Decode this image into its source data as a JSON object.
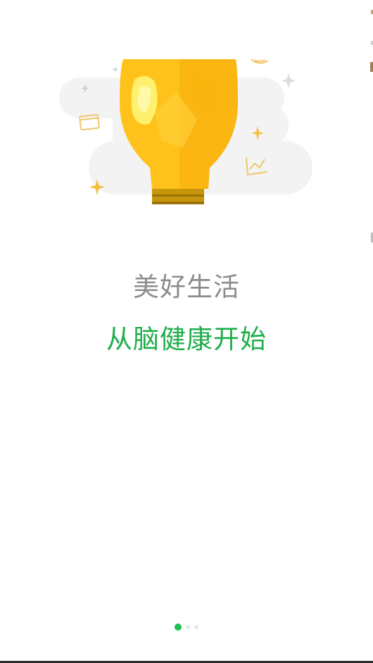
{
  "onboarding": {
    "headline_primary": "美好生活",
    "headline_secondary": "从脑健康开始",
    "illustration_icon": "lightbulb-icon",
    "page_indicator": {
      "total": 3,
      "active_index": 0
    }
  },
  "colors": {
    "accent_green": "#1fae4a",
    "indicator_active": "#1fc14f",
    "indicator_inactive": "#e6e6e6",
    "bulb_yellow": "#ffc21a",
    "headline_gray": "#8c8c8c"
  }
}
